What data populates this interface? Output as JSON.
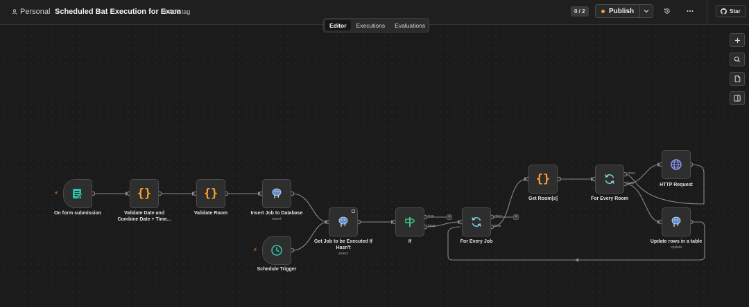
{
  "header": {
    "workspace": "Personal",
    "workflow_title": "Scheduled Bat Execution for Exam",
    "add_tag": "+ Add tag",
    "counter": "0 / 2",
    "publish_label": "Publish",
    "star_label": "Star"
  },
  "tabs": [
    {
      "label": "Editor",
      "active": true
    },
    {
      "label": "Executions",
      "active": false
    },
    {
      "label": "Evaluations",
      "active": false
    }
  ],
  "nodes": {
    "form": {
      "label": "On form submission"
    },
    "validate_date": {
      "label1": "Validate Date and",
      "label2": "Combine Date + Time..."
    },
    "validate_room": {
      "label": "Validate Room"
    },
    "insert_job": {
      "label": "Insert Job to Database",
      "sub": "insert"
    },
    "schedule": {
      "label": "Schedule Trigger"
    },
    "get_job": {
      "label1": "Get Job to be Executed If",
      "label2": "Hasn't",
      "sub": "select"
    },
    "if_node": {
      "label": "If",
      "port_true": "true",
      "port_false": "false"
    },
    "every_job": {
      "label": "For Every Job",
      "port_done": "done",
      "port_loop": "loop"
    },
    "get_room": {
      "label": "Get Room[s]"
    },
    "every_room": {
      "label": "For Every Room",
      "port_done": "done",
      "port_loop": "loop"
    },
    "http": {
      "label": "HTTP Request"
    },
    "update_rows": {
      "label": "Update rows in a table",
      "sub": "update"
    }
  },
  "colors": {
    "accent_orange": "#ff9b3d",
    "form_icon": "#2fc4b2",
    "code_icon": "#ff9f2e",
    "schedule_icon": "#2fc4a8",
    "if_icon": "#3fbf7f",
    "loop_icon": "#7fd0d8",
    "http_icon": "#8f9cff",
    "postgres_icon": "#5f8fcf"
  },
  "icons": [
    "person-icon",
    "chevron-down-icon",
    "history-icon",
    "ellipsis-icon",
    "github-icon",
    "plus-icon",
    "zoom-icon",
    "sticky-note-icon",
    "panel-icon",
    "form-icon",
    "code-braces-icon",
    "postgres-icon",
    "clock-icon",
    "if-signpost-icon",
    "loop-icon",
    "globe-icon",
    "bolt-icon"
  ]
}
